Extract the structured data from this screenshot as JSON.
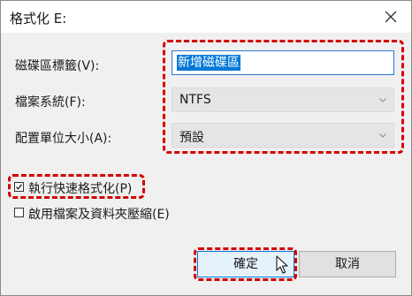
{
  "window": {
    "title": "格式化 E:"
  },
  "form": {
    "volume_label": {
      "label": "磁碟區標籤(V):",
      "value": "新增磁碟區"
    },
    "file_system": {
      "label": "檔案系統(F):",
      "value": "NTFS"
    },
    "allocation_unit_size": {
      "label": "配置單位大小(A):",
      "value": "預設"
    }
  },
  "options": {
    "quick_format": {
      "label": "執行快速格式化(P)",
      "checked": true
    },
    "enable_compression": {
      "label": "啟用檔案及資料夾壓縮(E)",
      "checked": false
    }
  },
  "buttons": {
    "ok_label": "確定",
    "cancel_label": "取消"
  },
  "colors": {
    "highlight_dash": "#d40000",
    "selection": "#0078d7",
    "dialog_background": "#f0f0f0"
  },
  "icons": {
    "close": "close-icon",
    "dropdown": "chevron-down-icon",
    "checkmark": "checkmark-icon",
    "cursor": "mouse-pointer-icon"
  }
}
